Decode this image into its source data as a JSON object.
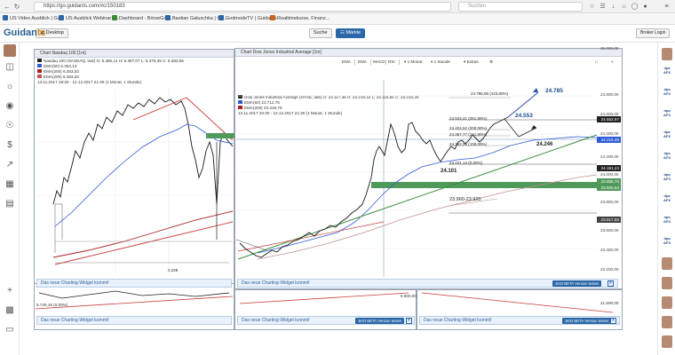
{
  "browser": {
    "url": "https://go.guidants.com/#c/150183",
    "search_placeholder": "Suchen",
    "bookmarks": [
      {
        "label": "US Video Ausblick | Gu..."
      },
      {
        "label": "US Ausblick Webinar | ..."
      },
      {
        "label": "Dashboard - BörseGo ..."
      },
      {
        "label": "Bastian Galuschka | Gu..."
      },
      {
        "label": "GodmodeTV | Guidants"
      },
      {
        "label": "Realtimekurse, Finanz..."
      }
    ]
  },
  "app": {
    "logo_main": "Guidan",
    "logo_accent": "ts",
    "desktop_label": "Desktop",
    "search_label": "Suche",
    "market_label": "Märkte",
    "login_label": "Broker Login",
    "colors": {
      "brand": "#2b67a8",
      "accent": "#e08a1e",
      "ema50": "#2f5bd6",
      "ema200": "#a82020",
      "zone": "#4f9a5a",
      "trend_green": "#3f8f3f",
      "trend_red": "#c83a3a"
    }
  },
  "left_rail_icons": [
    "avatar",
    "monitor-icon",
    "bulb-icon",
    "globe-icon",
    "eye-icon",
    "dollar-icon",
    "chart-line-icon",
    "calculator-icon",
    "newspaper-icon",
    "add-icon",
    "folder-icon",
    "document-icon"
  ],
  "nasdaq_window": {
    "title": "Chart Nasdaq 100 [1m]",
    "legend": [
      "Nasdaq 100 (NASDAQ, last)  O: 6.385,14  H: 6.387,07  L: 6.378,35  C: 6.383,65",
      "EMA(50)  6.353,13",
      "EMA(200)  6.353,53",
      "EMA(200)  6.383,53",
      "13.11.2017 19:30 - 12.12.2017 21:30  (1 Monat, 1 Stunde)"
    ],
    "annotation_low": "6.228",
    "notice": "Das neue Charting-Widget kommt!"
  },
  "dow_window": {
    "title": "Chart Dow Jones Industrial Average [1m]",
    "controls": [
      "EMA",
      "EMA",
      "MACD",
      "RSI",
      "1 Monat",
      "1 Stunde",
      "Extras"
    ],
    "legend": [
      "Dow Jones Industrial Average (NYSE, last)  O: 24.117,48  H: 24.219,16  L: 24.116,85  C: 24.219,30",
      "EMA(50)  23.712,75",
      "EMA(200)  23.419,70",
      "13.11.2017 20:30 - 12.12.2017 21:30  (1 Monat, 1 Stunde)"
    ],
    "fib_levels": [
      "24.785,95 (423,60%)",
      "24.524,41 (261,80%)",
      "24.424,52 (200,00%)",
      "24.367,77 (161,80%)",
      "24.262,06 (100,00%)",
      "24.101,14 (0,00%)"
    ],
    "targets": {
      "high": "24.785",
      "mid": "24.553",
      "alt": "24.246",
      "low": "24.101"
    },
    "zone_label": "23.960-23.920",
    "axis_ticks": [
      "25.000,00",
      "24.800,00",
      "24.600,00",
      "24.400,00",
      "24.200,00",
      "24.000,00",
      "23.800,00",
      "23.600,00",
      "23.400,00",
      "23.200,00"
    ],
    "price_tags": [
      {
        "label": "24.552,97",
        "color": "#222222"
      },
      {
        "label": "24.219,30",
        "color": "#2f5bd6"
      },
      {
        "label": "24.181,24",
        "color": "#222222"
      },
      {
        "label": "23.956,76",
        "color": "#4f9a5a"
      },
      {
        "label": "23.920,64",
        "color": "#4f9a5a"
      },
      {
        "label": "23.617,50",
        "color": "#444444"
      }
    ],
    "notice": "Das neue Charting-Widget kommt!",
    "beta_label": "Jetzt BETA Version testen"
  },
  "bottom_windows": {
    "left_axis_label": "5.745,16 (0,00%)",
    "mid_axis_label": "6.600,00",
    "right_axis_label": "21.500,00",
    "notice": "Das neue Charting-Widget kommt!",
    "beta_label": "Jetzt BETA Version testen"
  },
  "right_rail_badge": "dpa AFX"
}
